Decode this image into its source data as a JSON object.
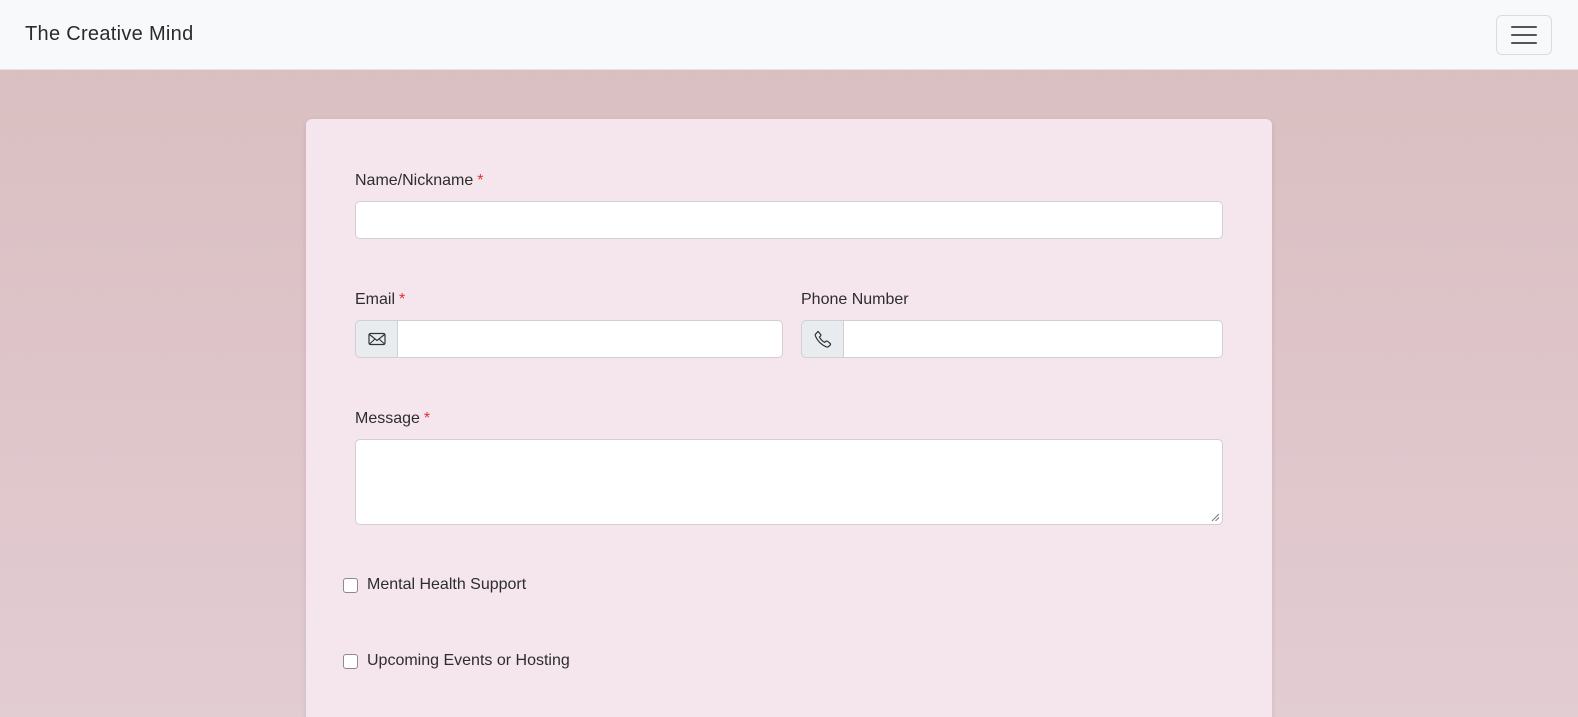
{
  "navbar": {
    "brand": "The Creative Mind",
    "toggler_icon": "hamburger-menu-icon"
  },
  "form": {
    "name": {
      "label": "Name/Nickname",
      "required_mark": "*",
      "value": ""
    },
    "email": {
      "label": "Email",
      "required_mark": "*",
      "icon": "envelope-icon",
      "value": ""
    },
    "phone": {
      "label": "Phone Number",
      "icon": "phone-icon",
      "value": ""
    },
    "message": {
      "label": "Message",
      "required_mark": "*",
      "value": ""
    },
    "checkboxes": [
      {
        "label": "Mental Health Support",
        "checked": false
      },
      {
        "label": "Upcoming Events or Hosting",
        "checked": false
      }
    ]
  },
  "colors": {
    "navbar_bg": "#f8f9fb",
    "page_bg": "#d9bebf",
    "card_bg": "#f5e6ed",
    "required": "#e03131"
  }
}
